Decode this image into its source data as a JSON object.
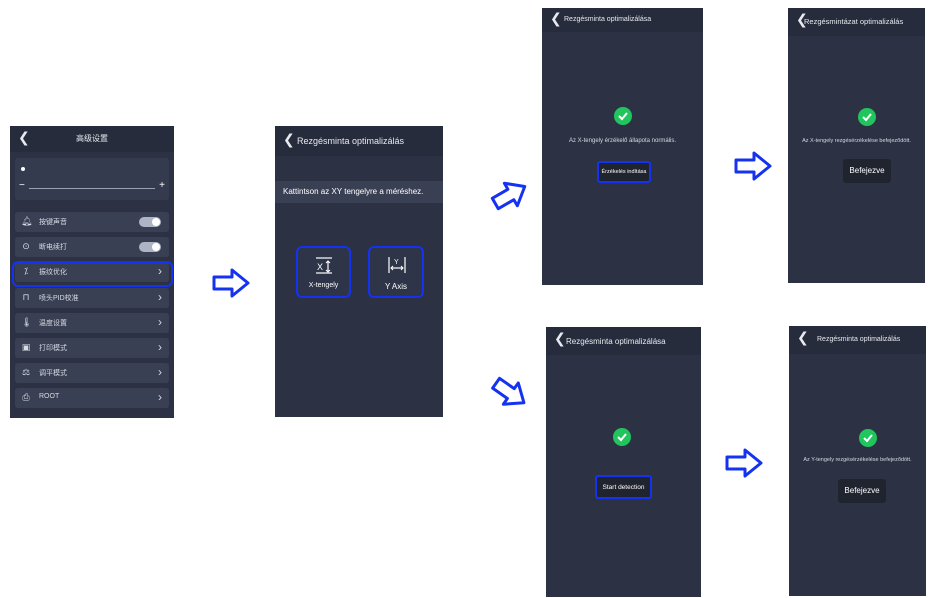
{
  "screen1": {
    "title": "高级设置",
    "slider": {
      "minus": "−",
      "plus": "+"
    },
    "items": [
      {
        "icon": "bell-icon",
        "label": "按键声音",
        "control": "toggle"
      },
      {
        "icon": "power-resume-icon",
        "label": "断电续打",
        "control": "toggle"
      },
      {
        "icon": "vibration-icon",
        "label": "振纹优化",
        "control": "chevron",
        "highlighted": true
      },
      {
        "icon": "nozzle-icon",
        "label": "喷头PID校准",
        "control": "chevron"
      },
      {
        "icon": "thermometer-icon",
        "label": "温度设置",
        "control": "chevron"
      },
      {
        "icon": "print-mode-icon",
        "label": "打印模式",
        "control": "chevron"
      },
      {
        "icon": "leveling-icon",
        "label": "调平模式",
        "control": "chevron"
      },
      {
        "icon": "printer-icon",
        "label": "ROOT",
        "control": "chevron"
      }
    ]
  },
  "screen2": {
    "title": "Rezgésminta optimalizálás",
    "instruction": "Kattintson az XY tengelyre a méréshez.",
    "x_button": "X-tengely",
    "y_button": "Y Axis"
  },
  "screen3": {
    "title": "Rezgésminta optimalizálása",
    "status": "Az X-tengely érzékelő állapota normális.",
    "button": "Érzékelés indítása"
  },
  "screen4": {
    "title": "Rezgésmintázat optimalizálás",
    "status": "Az X-tengely rezgésérzékelése befejeződött.",
    "button": "Befejezve"
  },
  "screen5": {
    "title": "Rezgésminta optimalizálása",
    "status": "",
    "button": "Start detection"
  },
  "screen6": {
    "title": "Rezgésminta optimalizálás",
    "status": "Az Y-tengely rezgésérzékelése befejeződött.",
    "button": "Befejezve"
  },
  "colors": {
    "screen_bg": "#2c3244",
    "highlight": "#1432f0",
    "success": "#21c55d"
  }
}
